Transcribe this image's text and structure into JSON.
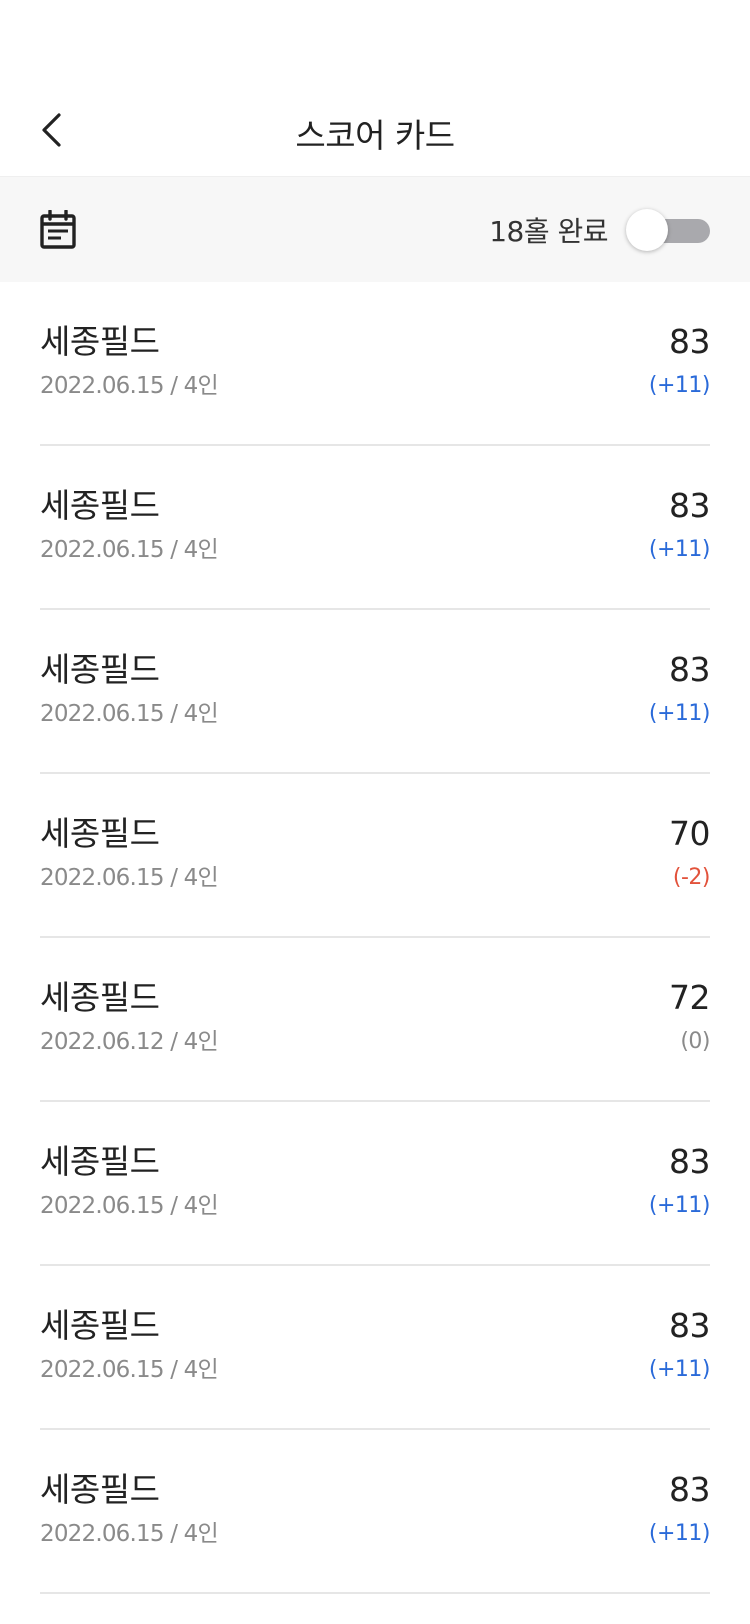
{
  "header": {
    "title": "스코어 카드",
    "back_icon": "chevron-left-icon"
  },
  "filter": {
    "calendar_icon": "calendar-icon",
    "toggle_label": "18홀 완료",
    "toggle_on": false
  },
  "colors": {
    "over_par": "#2a6ad9",
    "under_par": "#e2523b",
    "even_par": "#8a8a8a",
    "toggle_track": "#a9a9ad",
    "filter_bg": "#f7f7f7"
  },
  "rounds": [
    {
      "course": "세종필드",
      "meta": "2022.06.15 / 4인",
      "score": "83",
      "diff": "(+11)",
      "status": "over"
    },
    {
      "course": "세종필드",
      "meta": "2022.06.15 / 4인",
      "score": "83",
      "diff": "(+11)",
      "status": "over"
    },
    {
      "course": "세종필드",
      "meta": "2022.06.15 / 4인",
      "score": "83",
      "diff": "(+11)",
      "status": "over"
    },
    {
      "course": "세종필드",
      "meta": "2022.06.15 / 4인",
      "score": "70",
      "diff": "(-2)",
      "status": "under"
    },
    {
      "course": "세종필드",
      "meta": "2022.06.12 / 4인",
      "score": "72",
      "diff": "(0)",
      "status": "even"
    },
    {
      "course": "세종필드",
      "meta": "2022.06.15 / 4인",
      "score": "83",
      "diff": "(+11)",
      "status": "over"
    },
    {
      "course": "세종필드",
      "meta": "2022.06.15 / 4인",
      "score": "83",
      "diff": "(+11)",
      "status": "over"
    },
    {
      "course": "세종필드",
      "meta": "2022.06.15 / 4인",
      "score": "83",
      "diff": "(+11)",
      "status": "over"
    }
  ]
}
